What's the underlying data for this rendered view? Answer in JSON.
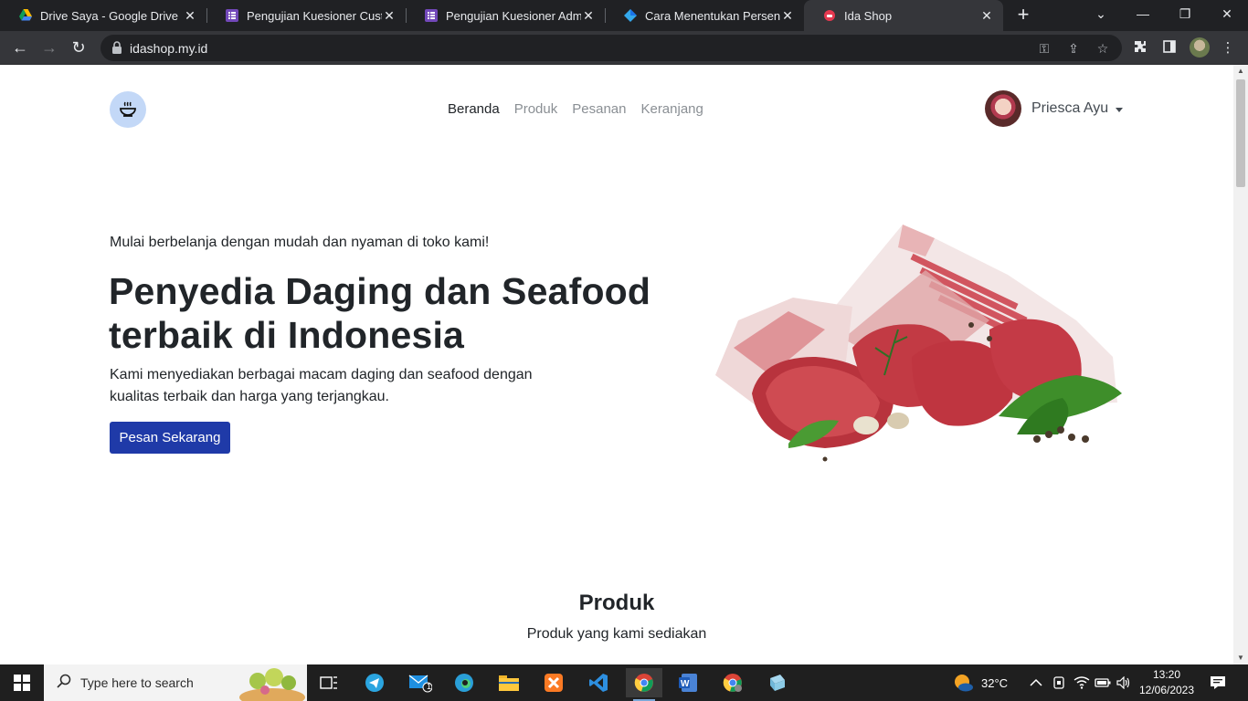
{
  "browser": {
    "tabs": [
      {
        "title": "Drive Saya - Google Drive",
        "icon": "google-drive-icon"
      },
      {
        "title": "Pengujian Kuesioner Customer",
        "icon": "google-forms-icon"
      },
      {
        "title": "Pengujian Kuesioner Admin -",
        "icon": "google-forms-icon"
      },
      {
        "title": "Cara Menentukan Persentase",
        "icon": "diamond-icon"
      },
      {
        "title": "Ida Shop",
        "icon": "ida-shop-favicon"
      }
    ],
    "url": "idashop.my.id"
  },
  "site": {
    "nav": [
      "Beranda",
      "Produk",
      "Pesanan",
      "Keranjang"
    ],
    "user_name": "Priesca Ayu",
    "hero": {
      "tagline": "Mulai berbelanja dengan mudah dan nyaman di toko kami!",
      "title": "Penyedia Daging dan Seafood terbaik di Indonesia",
      "description": "Kami menyediakan berbagai macam daging dan seafood dengan kualitas terbaik dan harga yang terjangkau.",
      "cta": "Pesan Sekarang"
    },
    "products_section": {
      "title": "Produk",
      "subtitle": "Produk yang kami sediakan"
    }
  },
  "taskbar": {
    "search_placeholder": "Type here to search",
    "weather": "32°C",
    "time": "13:20",
    "date": "12/06/2023",
    "mail_badge": "1"
  },
  "colors": {
    "brand_button": "#1f3aa8",
    "logo_bg": "#c3d8f7"
  }
}
